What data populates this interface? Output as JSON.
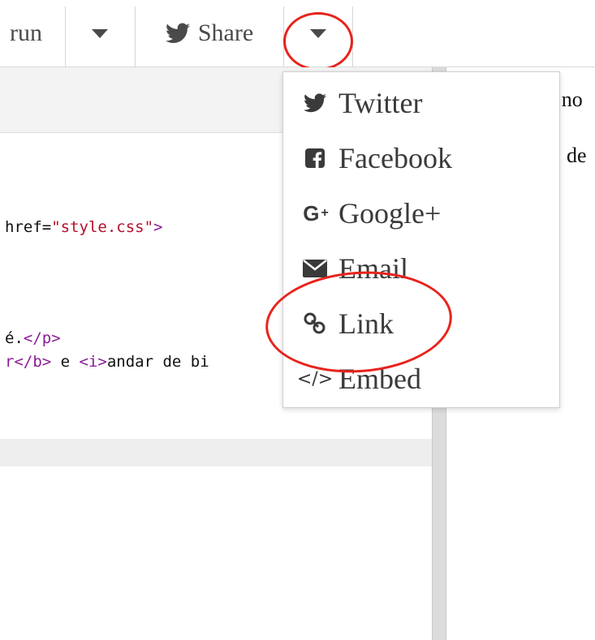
{
  "toolbar": {
    "run_label": "run",
    "share_label": "Share"
  },
  "editor": {
    "lines": {
      "l1_attr": "href=",
      "l1_str": "\"style.css\"",
      "l1_end": ">",
      "l2_text": "é.",
      "l2_tag": "</p>",
      "l3_tag1": "r</b>",
      "l3_mid": " e ",
      "l3_tag2": "<i>",
      "l3_rest": "andar de bi"
    }
  },
  "preview": {
    "line1": "ı no",
    "line2": "de"
  },
  "share_menu": {
    "items": [
      {
        "label": "Twitter",
        "icon": "twitter-icon"
      },
      {
        "label": "Facebook",
        "icon": "facebook-icon"
      },
      {
        "label": "Google+",
        "icon": "google-plus-icon"
      },
      {
        "label": "Email",
        "icon": "email-icon"
      },
      {
        "label": "Link",
        "icon": "link-icon"
      },
      {
        "label": "Embed",
        "icon": "embed-icon"
      }
    ]
  },
  "annotations": {
    "color": "#e8231c"
  }
}
